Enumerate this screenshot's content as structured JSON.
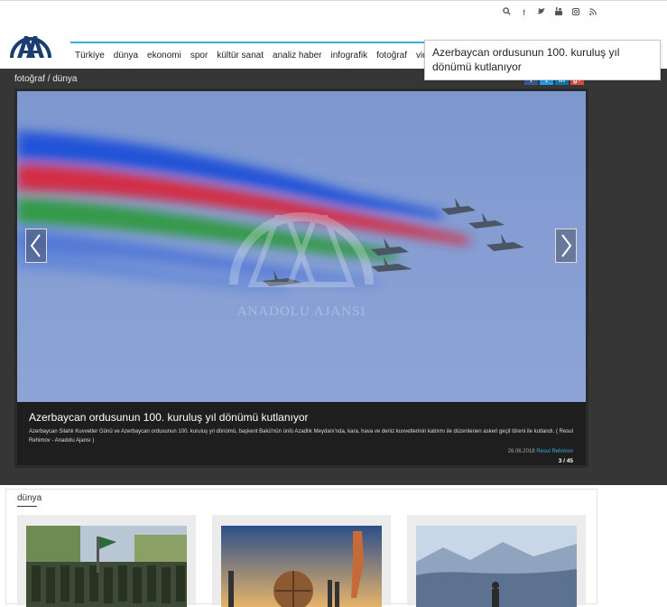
{
  "header": {
    "social_icons": [
      "search-icon",
      "facebook-icon",
      "twitter-icon",
      "youtube-icon",
      "instagram-icon",
      "rss-icon"
    ],
    "nav": [
      "Türkiye",
      "dünya",
      "ekonomi",
      "spor",
      "kültür sanat",
      "analiz haber",
      "infografik",
      "fotoğraf",
      "video"
    ]
  },
  "tooltip": {
    "text": "Azerbaycan ordusunun 100. kuruluş yıl dönümü kutlanıyor"
  },
  "gallery": {
    "breadcrumb": "fotoğraf / dünya",
    "share_icons": [
      "facebook-icon",
      "twitter-icon",
      "linkedin-icon",
      "googleplus-icon"
    ],
    "watermark": "ANADOLU AJANSI",
    "caption_title": "Azerbaycan ordusunun 100. kuruluş yıl dönümü kutlanıyor",
    "caption_body": "Azerbaycan Silahlı Kuvvetler Günü ve Azerbaycan ordusunun 100. kuruluş yıl dönümü, başkent Bakü'nün ünlü Azadlık Meydanı'nda, kara, hava ve deniz kuvvetlerinin katılımı ile düzenlenen askeri geçit töreni ile kutlandı. ( Resul Rehimov - Anadolu Ajansı )",
    "date": "26.06.2018",
    "author": "Resul Rehimov",
    "counter": "3 / 45",
    "colors": {
      "blue": "#1f4fd8",
      "red": "#d9263c",
      "green": "#2d9a3e",
      "sky": "#7f9ad2"
    }
  },
  "section": {
    "title": "dünya"
  }
}
